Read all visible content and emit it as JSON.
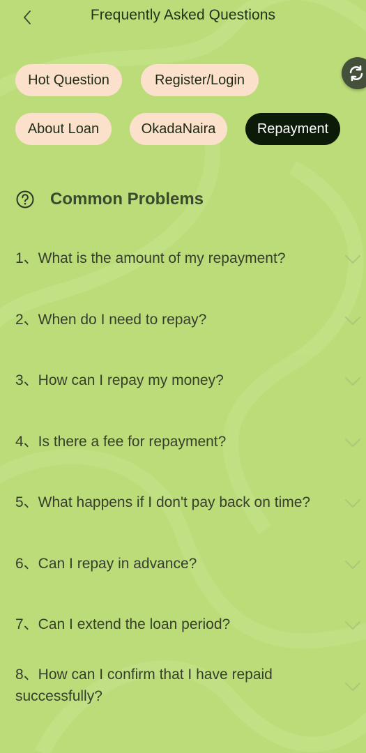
{
  "header": {
    "title": "Frequently Asked Questions",
    "back_icon": "chevron-left-icon"
  },
  "tabs": [
    {
      "label": "Hot Question",
      "active": false
    },
    {
      "label": "Register/Login",
      "active": false
    },
    {
      "label": "About Loan",
      "active": false
    },
    {
      "label": "OkadaNaira",
      "active": false
    },
    {
      "label": "Repayment",
      "active": true
    }
  ],
  "refresh_icon": "refresh-icon",
  "section": {
    "icon": "question-circle-icon",
    "title": "Common Problems"
  },
  "faqs": [
    {
      "number": "1",
      "question": "1、What is the amount of my repayment?"
    },
    {
      "number": "2",
      "question": "2、When do I need to repay?"
    },
    {
      "number": "3",
      "question": "3、How can I repay my money?"
    },
    {
      "number": "4",
      "question": "4、Is there a fee for repayment?"
    },
    {
      "number": "5",
      "question": "5、What happens if I don't pay back on time?"
    },
    {
      "number": "6",
      "question": "6、Can I repay in advance?"
    },
    {
      "number": "7",
      "question": "7、Can I extend the loan period?"
    },
    {
      "number": "8",
      "question": "8、How can I confirm that I have repaid successfully?"
    }
  ],
  "colors": {
    "background": "#bcdc7a",
    "chip": "#fbe0cc",
    "chip_active": "#0c1a08",
    "text": "#353f2b"
  }
}
